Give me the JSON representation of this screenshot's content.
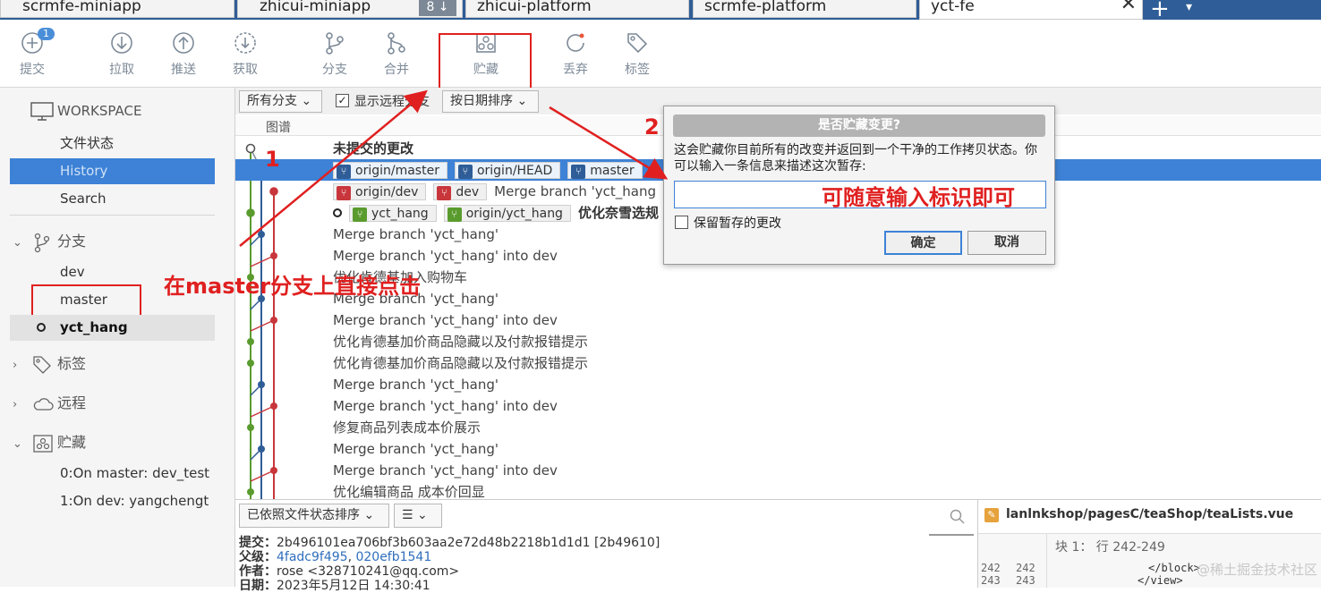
{
  "tabs": [
    {
      "label": "scrmfe-miniapp"
    },
    {
      "label": "zhicui-miniapp",
      "count": "8 ↓"
    },
    {
      "label": "zhicui-platform"
    },
    {
      "label": "scrmfe-platform"
    },
    {
      "label": "yct-fe",
      "close": "✕"
    }
  ],
  "tab_plus": "+",
  "tab_menu": "▾",
  "toolbar": {
    "commit": "提交",
    "commit_badge": "1",
    "pull": "拉取",
    "push": "推送",
    "fetch": "获取",
    "branch": "分支",
    "merge": "合并",
    "stash": "贮藏",
    "discard": "丢弃",
    "tag": "标签"
  },
  "sidebar": {
    "workspace": "WORKSPACE",
    "file_status": "文件状态",
    "history": "History",
    "search": "Search",
    "branches": "分支",
    "branch_items": [
      "dev",
      "master",
      "yct_hang"
    ],
    "tags": "标签",
    "remotes": "远程",
    "stashes": "贮藏",
    "stash_items": [
      "0:On master: dev_test",
      "1:On dev: yangchengt"
    ]
  },
  "graph": {
    "branch_filter": "所有分支 ⌄",
    "show_remote": "显示远程分支",
    "sort": "按日期排序 ⌄",
    "col_graph": "图谱",
    "uncommitted": "未提交的更改",
    "row1_refs": [
      "origin/master",
      "origin/HEAD",
      "master"
    ],
    "row2_refs": [
      "origin/dev",
      "dev"
    ],
    "row2_msg": "Merge branch 'yct_hang",
    "row3_refs": [
      "yct_hang",
      "origin/yct_hang"
    ],
    "row3_msg": "优化奈雪选规",
    "messages": [
      "Merge branch 'yct_hang'",
      "Merge branch 'yct_hang' into dev",
      "优化肯德基加入购物车",
      "Merge branch 'yct_hang'",
      "Merge branch 'yct_hang' into dev",
      "优化肯德基加价商品隐藏以及付款报错提示",
      "优化肯德基加价商品隐藏以及付款报错提示",
      "Merge branch 'yct_hang'",
      "Merge branch 'yct_hang' into dev",
      "修复商品列表成本价展示",
      "Merge branch 'yct_hang'",
      "Merge branch 'yct_hang' into dev",
      "优化编辑商品 成本价回显"
    ]
  },
  "bottom": {
    "sort_files": "已依照文件状态排序 ⌄",
    "view_mode": "☰ ⌄",
    "commit_label": "提交：",
    "commit_hash": "2b496101ea706bf3b603aa2e72d48b2218b1d1d1 [2b49610]",
    "parent_label": "父级：",
    "parent_a": "4fadc9f495",
    "parent_sep": ", ",
    "parent_b": "020efb1541",
    "author_label": "作者：",
    "author": "rose <328710241@qq.com>",
    "date_label": "日期：",
    "date": "2023年5月12日 14:30:41",
    "file_path": "lanlnkshop/pagesC/teaShop/teaLists.vue",
    "hunk": "块 1： 行 242-249",
    "line1_a": "242",
    "line1_b": "242",
    "line1_code": "</block>",
    "line2_a": "243",
    "line2_b": "243",
    "line2_code": "</view>",
    "watermark": "@稀土掘金技术社区"
  },
  "dialog": {
    "title": "是否贮藏变更?",
    "text": "这会贮藏你目前所有的改变并返回到一个干净的工作拷贝状态。你可以输入一条信息来描述这次暂存:",
    "input_value": "",
    "keep_staged": "保留暂存的更改",
    "ok": "确定",
    "cancel": "取消"
  },
  "annotations": {
    "num1": "1",
    "num2": "2",
    "click_master": "在master分支上直接点击",
    "input_hint": "可随意输入标识即可",
    "red": "#e02020"
  },
  "colors": {
    "selection": "#3d82d6",
    "tabbar": "#2f5d97",
    "branch_green": "#5a9b2e",
    "branch_red": "#c8363b",
    "branch_blue": "#2f5d97"
  }
}
